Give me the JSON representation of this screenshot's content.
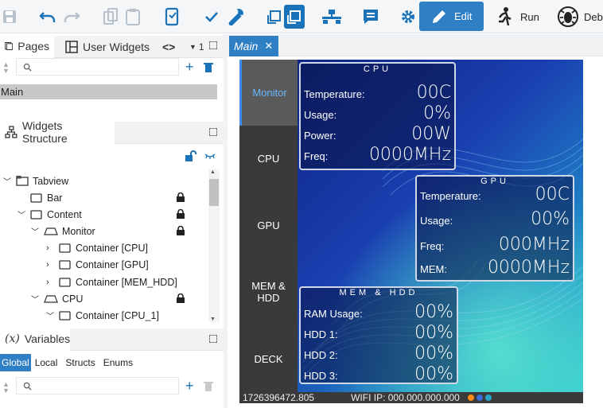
{
  "toolbar": {
    "edit_label": "Edit",
    "run_label": "Run",
    "debug_label": "Debu"
  },
  "pages_panel": {
    "tabs": [
      {
        "label": "Pages"
      },
      {
        "label": "User Widgets"
      },
      {
        "label": "<>"
      },
      {
        "label": "1"
      }
    ],
    "search_placeholder": "",
    "items": [
      "Main"
    ]
  },
  "structure_panel": {
    "title": "Widgets Structure",
    "tree": [
      {
        "label": "Tabview"
      },
      {
        "label": "Bar"
      },
      {
        "label": "Content"
      },
      {
        "label": "Monitor"
      },
      {
        "label": "Container [CPU]"
      },
      {
        "label": "Container [GPU]"
      },
      {
        "label": "Container [MEM_HDD]"
      },
      {
        "label": "CPU"
      },
      {
        "label": "Container [CPU_1]"
      }
    ]
  },
  "variables_panel": {
    "title": "Variables",
    "icon_text": "(x)",
    "tabs": [
      "Global",
      "Local",
      "Structs",
      "Enums"
    ]
  },
  "editor": {
    "tab_label": "Main",
    "device": {
      "nav": [
        "Monitor",
        "CPU",
        "GPU",
        "MEM &\nHDD",
        "DECK"
      ],
      "cpu": {
        "title": "CPU",
        "rows": [
          {
            "label": "Temperature:",
            "value": "00C"
          },
          {
            "label": "Usage:",
            "value": "0%"
          },
          {
            "label": "Power:",
            "value": "00W"
          },
          {
            "label": "Freq:",
            "value": "0000MHz"
          }
        ]
      },
      "gpu": {
        "title": "GPU",
        "rows": [
          {
            "label": "Temperature:",
            "value": "00C"
          },
          {
            "label": "Usage:",
            "value": "00%"
          },
          {
            "label": "Freq:",
            "value": "000MHz"
          },
          {
            "label": "MEM:",
            "value": "0000MHz"
          }
        ]
      },
      "mem": {
        "title": "MEM & HDD",
        "rows": [
          {
            "label": "RAM Usage:",
            "value": "00%"
          },
          {
            "label": "HDD 1:",
            "value": "00%"
          },
          {
            "label": "HDD 2:",
            "value": "00%"
          },
          {
            "label": "HDD 3:",
            "value": "00%"
          }
        ]
      },
      "status": {
        "left": "1726396472.805",
        "wifi": "WIFI IP: 000.000.000.000"
      }
    }
  },
  "colors": {
    "accent": "#2f7fc4",
    "nav_active_text": "#6ab7ff"
  }
}
